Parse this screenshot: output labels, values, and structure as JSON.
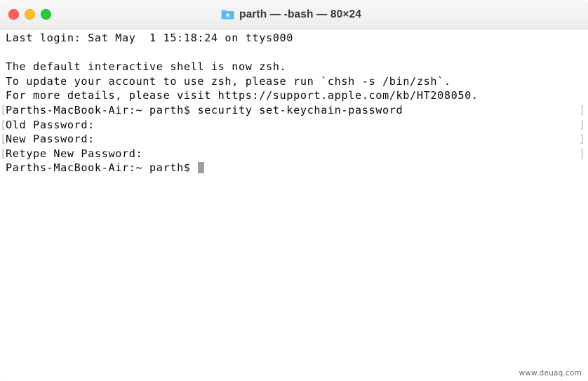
{
  "window": {
    "title": "parth — -bash — 80×24",
    "icon": "folder-home-icon",
    "controls": {
      "close_label": "close",
      "minimize_label": "minimize",
      "zoom_label": "zoom",
      "close_color": "#ff5f57",
      "minimize_color": "#febc2e",
      "zoom_color": "#28c840"
    },
    "titlebar_color": "#f2f2f2",
    "body_color": "#ffffff"
  },
  "terminal": {
    "foreground_color": "#0b0b0b",
    "prompt_mark_color": "#b9b9b9",
    "cursor_color": "#9d9d9d",
    "columns": 80,
    "rows": 24,
    "lines": [
      {
        "text": "Last login: Sat May  1 15:18:24 on ttys000",
        "marked": false,
        "cursor": false
      },
      {
        "text": "",
        "marked": false,
        "cursor": false
      },
      {
        "text": "The default interactive shell is now zsh.",
        "marked": false,
        "cursor": false
      },
      {
        "text": "To update your account to use zsh, please run `chsh -s /bin/zsh`.",
        "marked": false,
        "cursor": false
      },
      {
        "text": "For more details, please visit https://support.apple.com/kb/HT208050.",
        "marked": false,
        "cursor": false
      },
      {
        "text": "Parths-MacBook-Air:~ parth$ security set-keychain-password",
        "marked": true,
        "cursor": false
      },
      {
        "text": "Old Password:",
        "marked": true,
        "cursor": false
      },
      {
        "text": "New Password:",
        "marked": true,
        "cursor": false
      },
      {
        "text": "Retype New Password:",
        "marked": true,
        "cursor": false
      },
      {
        "text": "Parths-MacBook-Air:~ parth$ ",
        "marked": false,
        "cursor": true
      }
    ]
  },
  "watermark": {
    "text": "www.deuaq.com"
  }
}
